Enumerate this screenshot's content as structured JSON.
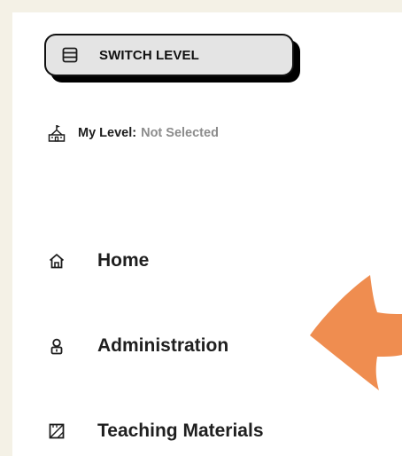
{
  "switch_button": {
    "label": "SWITCH LEVEL",
    "icon": "list-icon"
  },
  "level": {
    "key": "My Level:",
    "value": "Not Selected",
    "icon": "school-icon"
  },
  "nav": {
    "items": [
      {
        "label": "Home",
        "icon": "home-icon"
      },
      {
        "label": "Administration",
        "icon": "admin-icon"
      },
      {
        "label": "Teaching Materials",
        "icon": "materials-icon"
      }
    ]
  },
  "colors": {
    "page_background": "#f4f1e6",
    "panel": "#ffffff",
    "button_fill": "#e4e4e4",
    "button_shadow": "#000000",
    "muted_text": "#8c8c8c",
    "arrow": "#ef8d50"
  }
}
